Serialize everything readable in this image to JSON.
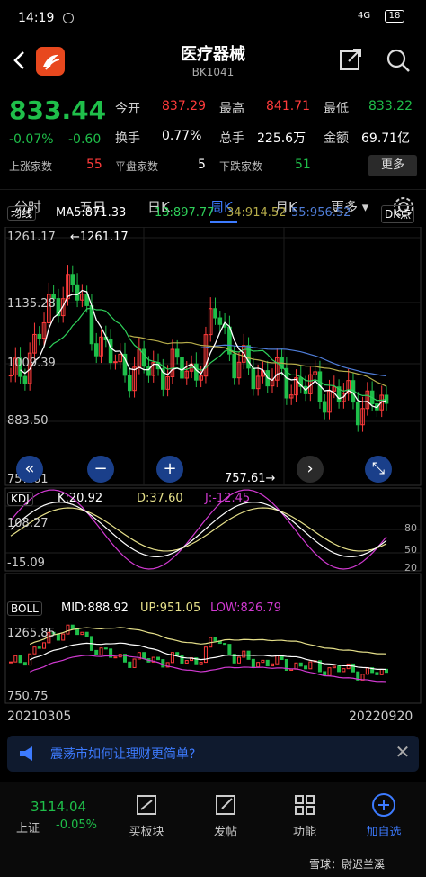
{
  "status": {
    "time": "14:19",
    "network": "4G",
    "battery": "18"
  },
  "header": {
    "title": "医疗器械",
    "code": "BK1041"
  },
  "quote": {
    "price": "833.44",
    "change_pct": "-0.07%",
    "change": "-0.60",
    "open_label": "今开",
    "open": "837.29",
    "high_label": "最高",
    "high": "841.71",
    "low_label": "最低",
    "low": "833.22",
    "turnover_label": "换手",
    "turnover": "0.77%",
    "volume_label": "总手",
    "volume": "225.6万",
    "amount_label": "金额",
    "amount": "69.71亿",
    "up_label": "上涨家数",
    "up_count": "55",
    "flat_label": "平盘家数",
    "flat_count": "5",
    "down_label": "下跌家数",
    "down_count": "51",
    "more_label": "更多"
  },
  "tabs": [
    {
      "label": "分时"
    },
    {
      "label": "五日"
    },
    {
      "label": "日K"
    },
    {
      "label": "周K"
    },
    {
      "label": "月K"
    },
    {
      "label": "更多 ▾"
    }
  ],
  "chart": {
    "ma_selector": "均线",
    "ma5": "MA5:871.33",
    "ma13": "13:897.77",
    "ma34": "34:914.52",
    "ma55": "55:956.52",
    "dk_label": "DK点",
    "y_ticks": [
      "1261.17",
      "1135.28",
      "1009.39",
      "883.50",
      "757.61"
    ],
    "max_annot": "←1261.17",
    "min_annot": "757.61→",
    "kdj": {
      "selector": "KDJ",
      "k": "K:20.92",
      "d": "D:37.60",
      "j": "J:-12.45",
      "top": "108.27",
      "bottom": "-15.09",
      "right_ticks": [
        "80",
        "50",
        "20"
      ]
    },
    "boll": {
      "selector": "BOLL",
      "mid": "MID:888.92",
      "up": "UP:951.05",
      "low": "LOW:826.79",
      "top": "1265.85",
      "bottom": "750.75"
    },
    "start_date": "20210305",
    "end_date": "20220920"
  },
  "banner": {
    "text": "震荡市如何让理财更简单?"
  },
  "bottom": {
    "index_value": "3114.04",
    "index_name": "上证",
    "index_change": "-0.05%",
    "items": [
      {
        "label": "买板块"
      },
      {
        "label": "发帖"
      },
      {
        "label": "功能"
      },
      {
        "label": "加自选"
      }
    ],
    "watermark": "雪球：尉迟兰溪"
  },
  "colors": {
    "up": "#ff3b3b",
    "down": "#1fbf4a",
    "accent": "#3d7bff",
    "ma5": "#ffffff",
    "ma13": "#2fd05a",
    "ma34": "#b7ad4a",
    "ma55": "#4f7dd8"
  }
}
